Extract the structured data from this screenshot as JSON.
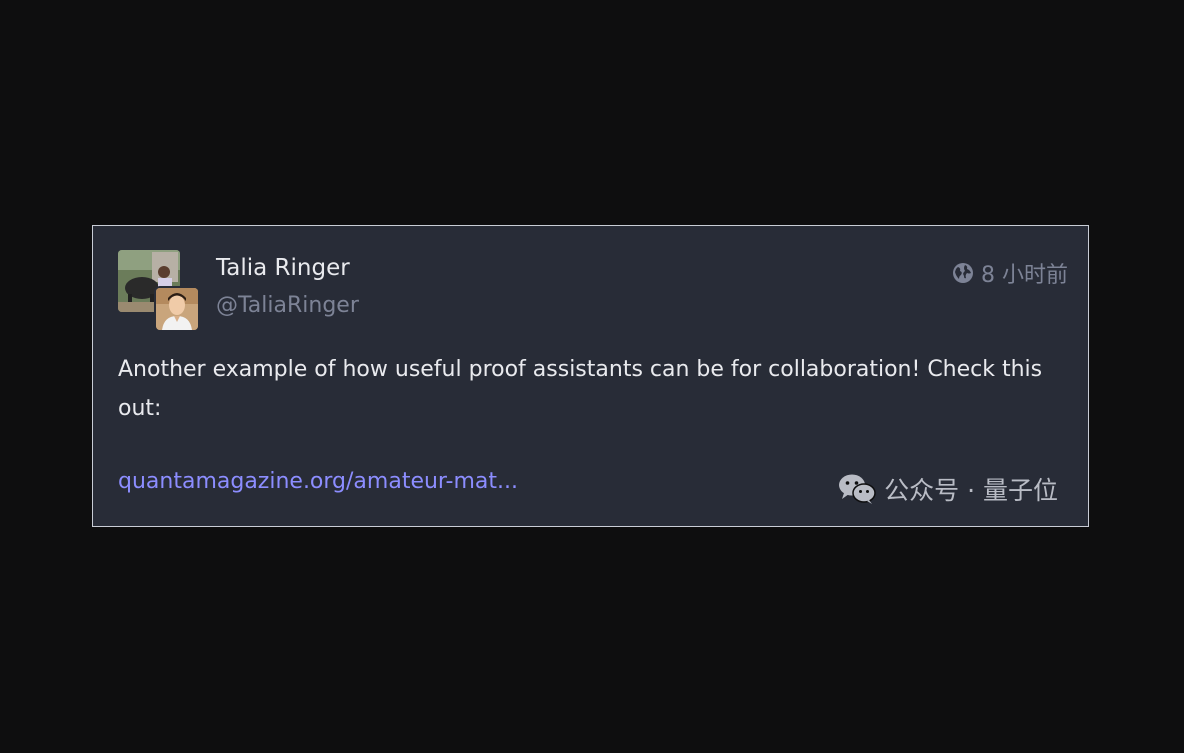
{
  "post": {
    "author": {
      "display_name": "Talia Ringer",
      "handle": "@TaliaRinger",
      "avatar_icon": "user-avatar-icon",
      "secondary_avatar_icon": "user-avatar-icon"
    },
    "visibility_icon": "globe-icon",
    "time_ago": "8 小时前",
    "content": "Another example of how useful proof assistants can be for collaboration! Check this out:",
    "link_text": "quantamagazine.org/amateur-mat..."
  },
  "watermark": {
    "icon": "wechat-icon",
    "text": "公众号 · 量子位"
  },
  "colors": {
    "page_background": "#0e0e0f",
    "card_background": "#282c37",
    "link": "#8c8dff",
    "muted_text": "#7d8396"
  }
}
